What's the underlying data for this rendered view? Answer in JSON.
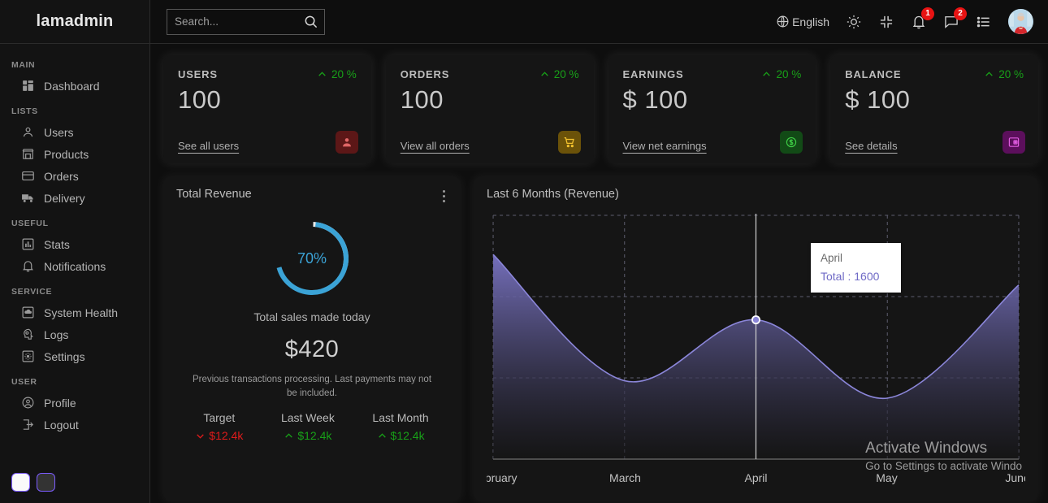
{
  "brand": "lamadmin",
  "sidebar": {
    "groups": [
      {
        "title": "MAIN",
        "items": [
          {
            "label": "Dashboard",
            "icon": "dashboard-icon"
          }
        ]
      },
      {
        "title": "LISTS",
        "items": [
          {
            "label": "Users",
            "icon": "user-icon"
          },
          {
            "label": "Products",
            "icon": "store-icon"
          },
          {
            "label": "Orders",
            "icon": "credit-card-icon"
          },
          {
            "label": "Delivery",
            "icon": "truck-icon"
          }
        ]
      },
      {
        "title": "USEFUL",
        "items": [
          {
            "label": "Stats",
            "icon": "bar-chart-icon"
          },
          {
            "label": "Notifications",
            "icon": "bell-icon"
          }
        ]
      },
      {
        "title": "SERVICE",
        "items": [
          {
            "label": "System Health",
            "icon": "cloud-icon"
          },
          {
            "label": "Logs",
            "icon": "psychology-icon"
          },
          {
            "label": "Settings",
            "icon": "gear-icon"
          }
        ]
      },
      {
        "title": "USER",
        "items": [
          {
            "label": "Profile",
            "icon": "account-circle-icon"
          },
          {
            "label": "Logout",
            "icon": "logout-icon"
          }
        ]
      }
    ],
    "theme_swatches": [
      "light",
      "dark"
    ]
  },
  "topbar": {
    "search_placeholder": "Search...",
    "search_value": "",
    "language": "English",
    "notifications_badge": "1",
    "messages_badge": "2",
    "icons": [
      "globe-icon",
      "sun-icon",
      "fullscreen-icon",
      "bell-icon",
      "chat-icon",
      "list-icon",
      "avatar"
    ]
  },
  "cards": [
    {
      "title": "USERS",
      "percent": "20 %",
      "trend": "up",
      "value": "100",
      "link": "See all users",
      "icon": "person-icon",
      "icon_bg": "#5c1717",
      "icon_color": "#e06666"
    },
    {
      "title": "ORDERS",
      "percent": "20 %",
      "trend": "up",
      "value": "100",
      "link": "View all orders",
      "icon": "cart-icon",
      "icon_bg": "#6b5209",
      "icon_color": "#f2c12e"
    },
    {
      "title": "EARNINGS",
      "percent": "20 %",
      "trend": "up",
      "value": "$ 100",
      "link": "View net earnings",
      "icon": "money-icon",
      "icon_bg": "#124a16",
      "icon_color": "#3fcf46"
    },
    {
      "title": "BALANCE",
      "percent": "20 %",
      "trend": "up",
      "value": "$ 100",
      "link": "See details",
      "icon": "wallet-icon",
      "icon_bg": "#5c0f5c",
      "icon_color": "#e05ce0"
    }
  ],
  "revenue": {
    "title": "Total Revenue",
    "donut_percent": "70%",
    "donut_value": 70,
    "donut_color": "#3ba3d6",
    "donut_track": "#eaeaea",
    "subtitle": "Total sales made today",
    "amount": "$420",
    "note": "Previous transactions processing. Last payments may not be included.",
    "stats": [
      {
        "name": "Target",
        "value": "$12.4k",
        "trend": "down"
      },
      {
        "name": "Last Week",
        "value": "$12.4k",
        "trend": "up"
      },
      {
        "name": "Last Month",
        "value": "$12.4k",
        "trend": "up"
      }
    ]
  },
  "chart_data": {
    "type": "area",
    "title": "Last 6 Months (Revenue)",
    "xlabel": "",
    "ylabel": "",
    "categories": [
      "February",
      "March",
      "April",
      "May",
      "June"
    ],
    "series": [
      {
        "name": "Total",
        "values": [
          2350,
          900,
          1600,
          700,
          2000
        ]
      }
    ],
    "ylim": [
      0,
      2800
    ],
    "grid": true,
    "legend": "none",
    "line_color": "#8b86d9",
    "fill_top": "#7a74c4",
    "fill_bottom": "#151515",
    "tooltip": {
      "label": "April",
      "value_label": "Total : 1600",
      "value": 1600
    }
  },
  "watermark": {
    "line1": "Activate Windows",
    "line2": "Go to Settings to activate Windo"
  }
}
